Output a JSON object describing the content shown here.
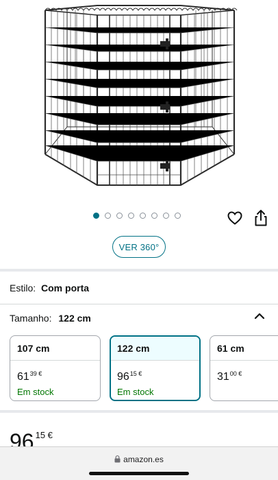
{
  "gallery": {
    "image_alt_icon": "dog-playpen-image",
    "dots_count": 8,
    "active_dot": 0,
    "view360_label": "VER 360°"
  },
  "style": {
    "label": "Estilo:",
    "value": "Com porta"
  },
  "size": {
    "label": "Tamanho:",
    "value": "122 cm"
  },
  "swatches": [
    {
      "size": "107 cm",
      "price_whole": "61",
      "price_frac": "39 €",
      "stock": "Em stock",
      "selected": false
    },
    {
      "size": "122 cm",
      "price_whole": "96",
      "price_frac": "15 €",
      "stock": "Em stock",
      "selected": true
    },
    {
      "size": "61 cm",
      "price_whole": "31",
      "price_frac": "00 €",
      "stock": "",
      "selected": false
    }
  ],
  "price": {
    "whole": "96",
    "frac": "15 €"
  },
  "browser": {
    "url": "amazon.es"
  },
  "colors": {
    "accent": "#007185",
    "stock_green": "#007600"
  }
}
